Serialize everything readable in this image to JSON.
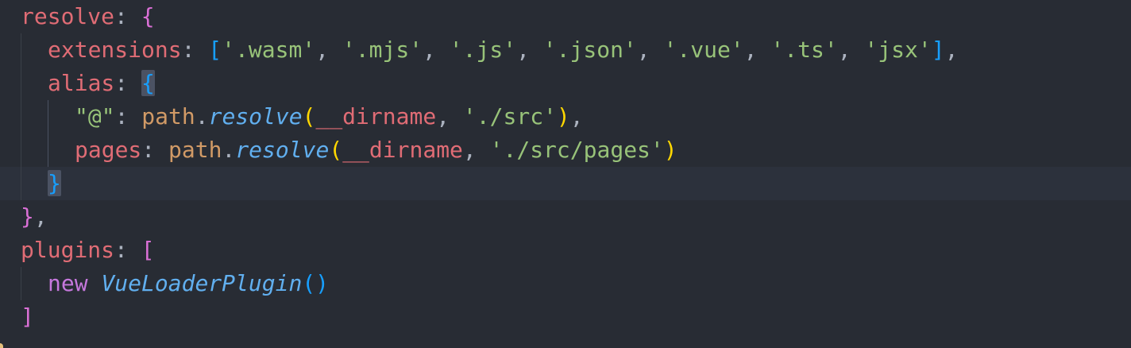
{
  "code": {
    "resolve_key": "resolve",
    "extensions_key": "extensions",
    "extensions": [
      "'.wasm'",
      "'.mjs'",
      "'.js'",
      "'.json'",
      "'.vue'",
      "'.ts'",
      "'jsx'"
    ],
    "alias_key": "alias",
    "alias_at_key": "\"@\"",
    "path_obj": "path",
    "resolve_fn": "resolve",
    "dirname": "__dirname",
    "src_path": "'./src'",
    "pages_key": "pages",
    "pages_path": "'./src/pages'",
    "plugins_key": "plugins",
    "new_kw": "new",
    "plugin_class": "VueLoaderPlugin"
  },
  "colors": {
    "background": "#282c34",
    "active_line": "#2c313c",
    "property": "#e06c75",
    "string": "#98c379",
    "object": "#d19a66",
    "function": "#61afef",
    "keyword": "#c678dd",
    "bracket_level1": "#da70d6",
    "bracket_level2": "#179fff",
    "bracket_level3": "#ffd700"
  }
}
